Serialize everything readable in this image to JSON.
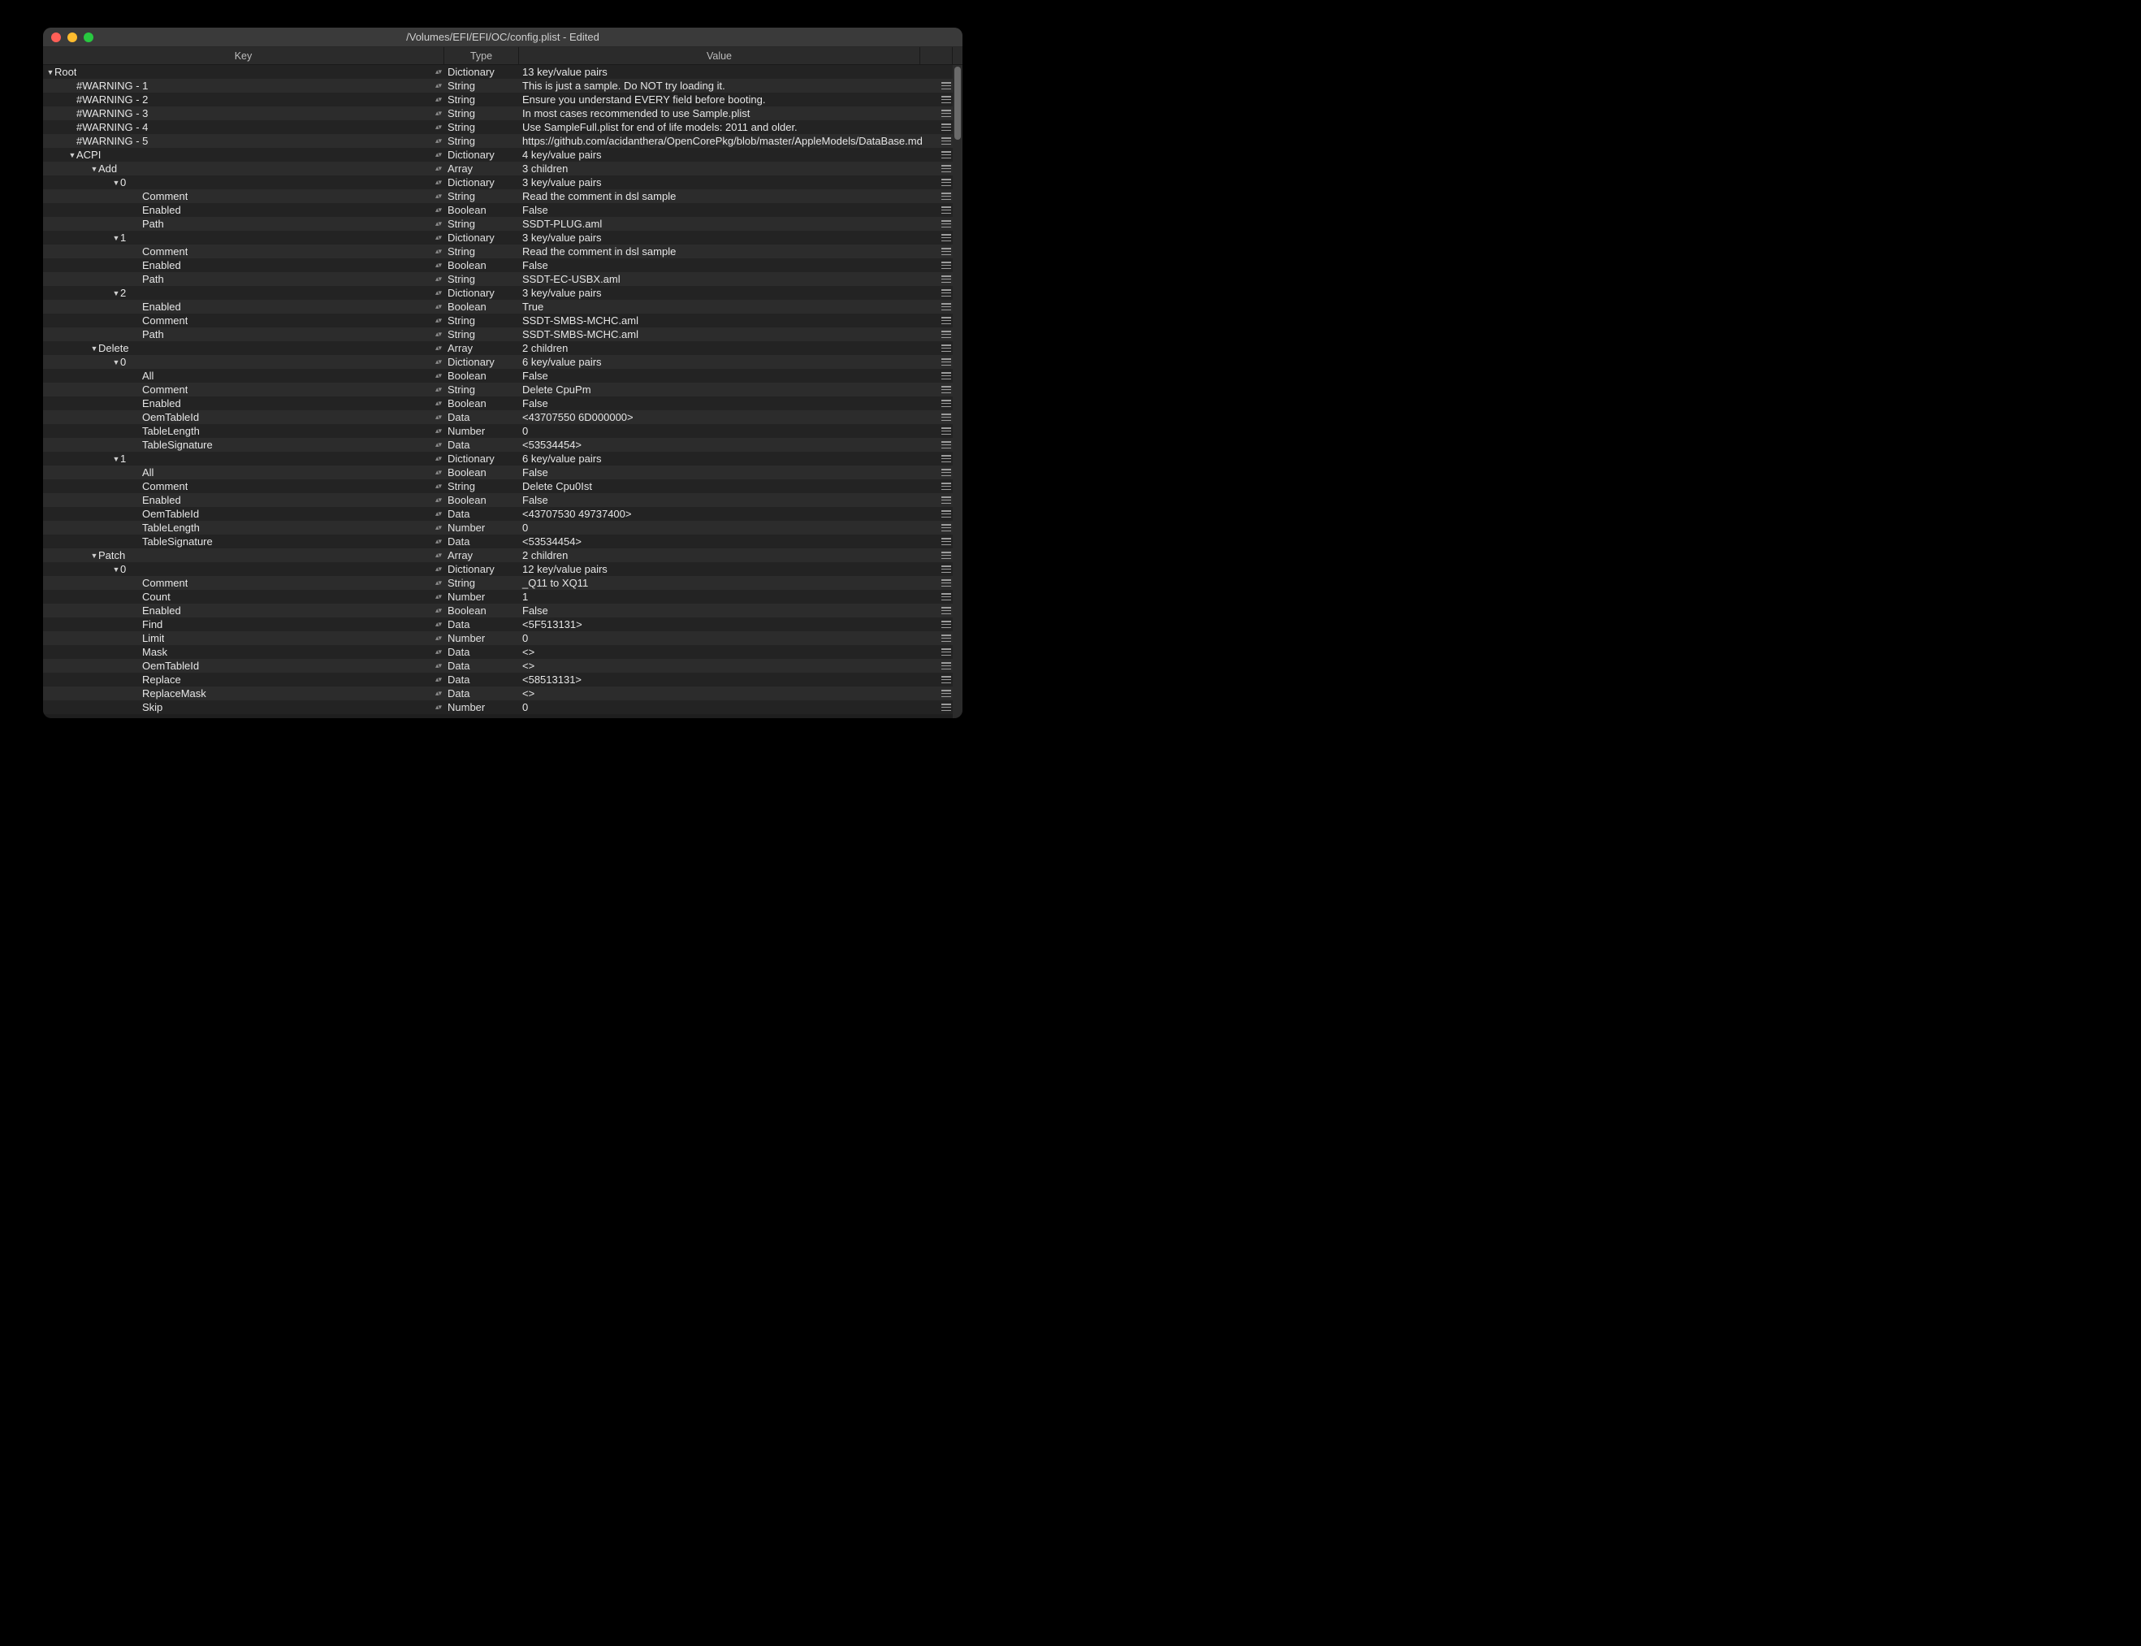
{
  "window": {
    "title": "/Volumes/EFI/EFI/OC/config.plist - Edited"
  },
  "columns": {
    "key": "Key",
    "type": "Type",
    "value": "Value"
  },
  "rows": [
    {
      "depth": 0,
      "arrow": "down",
      "key": "Root",
      "type": "Dictionary",
      "value": "13 key/value pairs",
      "handle": false
    },
    {
      "depth": 1,
      "arrow": "",
      "key": "#WARNING - 1",
      "type": "String",
      "value": "This is just a sample. Do NOT try loading it.",
      "handle": true
    },
    {
      "depth": 1,
      "arrow": "",
      "key": "#WARNING - 2",
      "type": "String",
      "value": "Ensure you understand EVERY field before booting.",
      "handle": true
    },
    {
      "depth": 1,
      "arrow": "",
      "key": "#WARNING - 3",
      "type": "String",
      "value": "In most cases recommended to use Sample.plist",
      "handle": true
    },
    {
      "depth": 1,
      "arrow": "",
      "key": "#WARNING - 4",
      "type": "String",
      "value": "Use SampleFull.plist for end of life models: 2011 and older.",
      "handle": true
    },
    {
      "depth": 1,
      "arrow": "",
      "key": "#WARNING - 5",
      "type": "String",
      "value": "https://github.com/acidanthera/OpenCorePkg/blob/master/AppleModels/DataBase.md",
      "handle": true
    },
    {
      "depth": 1,
      "arrow": "down",
      "key": "ACPI",
      "type": "Dictionary",
      "value": "4 key/value pairs",
      "handle": true
    },
    {
      "depth": 2,
      "arrow": "down",
      "key": "Add",
      "type": "Array",
      "value": "3 children",
      "handle": true
    },
    {
      "depth": 3,
      "arrow": "down",
      "key": "0",
      "type": "Dictionary",
      "value": "3 key/value pairs",
      "handle": true
    },
    {
      "depth": 4,
      "arrow": "",
      "key": "Comment",
      "type": "String",
      "value": "Read the comment in dsl sample",
      "handle": true
    },
    {
      "depth": 4,
      "arrow": "",
      "key": "Enabled",
      "type": "Boolean",
      "value": "False",
      "handle": true
    },
    {
      "depth": 4,
      "arrow": "",
      "key": "Path",
      "type": "String",
      "value": "SSDT-PLUG.aml",
      "handle": true
    },
    {
      "depth": 3,
      "arrow": "down",
      "key": "1",
      "type": "Dictionary",
      "value": "3 key/value pairs",
      "handle": true
    },
    {
      "depth": 4,
      "arrow": "",
      "key": "Comment",
      "type": "String",
      "value": "Read the comment in dsl sample",
      "handle": true
    },
    {
      "depth": 4,
      "arrow": "",
      "key": "Enabled",
      "type": "Boolean",
      "value": "False",
      "handle": true
    },
    {
      "depth": 4,
      "arrow": "",
      "key": "Path",
      "type": "String",
      "value": "SSDT-EC-USBX.aml",
      "handle": true
    },
    {
      "depth": 3,
      "arrow": "down",
      "key": "2",
      "type": "Dictionary",
      "value": "3 key/value pairs",
      "handle": true
    },
    {
      "depth": 4,
      "arrow": "",
      "key": "Enabled",
      "type": "Boolean",
      "value": "True",
      "handle": true
    },
    {
      "depth": 4,
      "arrow": "",
      "key": "Comment",
      "type": "String",
      "value": "SSDT-SMBS-MCHC.aml",
      "handle": true
    },
    {
      "depth": 4,
      "arrow": "",
      "key": "Path",
      "type": "String",
      "value": "SSDT-SMBS-MCHC.aml",
      "handle": true
    },
    {
      "depth": 2,
      "arrow": "down",
      "key": "Delete",
      "type": "Array",
      "value": "2 children",
      "handle": true
    },
    {
      "depth": 3,
      "arrow": "down",
      "key": "0",
      "type": "Dictionary",
      "value": "6 key/value pairs",
      "handle": true
    },
    {
      "depth": 4,
      "arrow": "",
      "key": "All",
      "type": "Boolean",
      "value": "False",
      "handle": true
    },
    {
      "depth": 4,
      "arrow": "",
      "key": "Comment",
      "type": "String",
      "value": "Delete CpuPm",
      "handle": true
    },
    {
      "depth": 4,
      "arrow": "",
      "key": "Enabled",
      "type": "Boolean",
      "value": "False",
      "handle": true
    },
    {
      "depth": 4,
      "arrow": "",
      "key": "OemTableId",
      "type": "Data",
      "value": "<43707550 6D000000>",
      "handle": true
    },
    {
      "depth": 4,
      "arrow": "",
      "key": "TableLength",
      "type": "Number",
      "value": "0",
      "handle": true
    },
    {
      "depth": 4,
      "arrow": "",
      "key": "TableSignature",
      "type": "Data",
      "value": "<53534454>",
      "handle": true
    },
    {
      "depth": 3,
      "arrow": "down",
      "key": "1",
      "type": "Dictionary",
      "value": "6 key/value pairs",
      "handle": true
    },
    {
      "depth": 4,
      "arrow": "",
      "key": "All",
      "type": "Boolean",
      "value": "False",
      "handle": true
    },
    {
      "depth": 4,
      "arrow": "",
      "key": "Comment",
      "type": "String",
      "value": "Delete Cpu0Ist",
      "handle": true
    },
    {
      "depth": 4,
      "arrow": "",
      "key": "Enabled",
      "type": "Boolean",
      "value": "False",
      "handle": true
    },
    {
      "depth": 4,
      "arrow": "",
      "key": "OemTableId",
      "type": "Data",
      "value": "<43707530 49737400>",
      "handle": true
    },
    {
      "depth": 4,
      "arrow": "",
      "key": "TableLength",
      "type": "Number",
      "value": "0",
      "handle": true
    },
    {
      "depth": 4,
      "arrow": "",
      "key": "TableSignature",
      "type": "Data",
      "value": "<53534454>",
      "handle": true
    },
    {
      "depth": 2,
      "arrow": "down",
      "key": "Patch",
      "type": "Array",
      "value": "2 children",
      "handle": true
    },
    {
      "depth": 3,
      "arrow": "down",
      "key": "0",
      "type": "Dictionary",
      "value": "12 key/value pairs",
      "handle": true
    },
    {
      "depth": 4,
      "arrow": "",
      "key": "Comment",
      "type": "String",
      "value": "_Q11 to XQ11",
      "handle": true
    },
    {
      "depth": 4,
      "arrow": "",
      "key": "Count",
      "type": "Number",
      "value": "1",
      "handle": true
    },
    {
      "depth": 4,
      "arrow": "",
      "key": "Enabled",
      "type": "Boolean",
      "value": "False",
      "handle": true
    },
    {
      "depth": 4,
      "arrow": "",
      "key": "Find",
      "type": "Data",
      "value": "<5F513131>",
      "handle": true
    },
    {
      "depth": 4,
      "arrow": "",
      "key": "Limit",
      "type": "Number",
      "value": "0",
      "handle": true
    },
    {
      "depth": 4,
      "arrow": "",
      "key": "Mask",
      "type": "Data",
      "value": "<>",
      "handle": true
    },
    {
      "depth": 4,
      "arrow": "",
      "key": "OemTableId",
      "type": "Data",
      "value": "<>",
      "handle": true
    },
    {
      "depth": 4,
      "arrow": "",
      "key": "Replace",
      "type": "Data",
      "value": "<58513131>",
      "handle": true
    },
    {
      "depth": 4,
      "arrow": "",
      "key": "ReplaceMask",
      "type": "Data",
      "value": "<>",
      "handle": true
    },
    {
      "depth": 4,
      "arrow": "",
      "key": "Skip",
      "type": "Number",
      "value": "0",
      "handle": true
    }
  ]
}
